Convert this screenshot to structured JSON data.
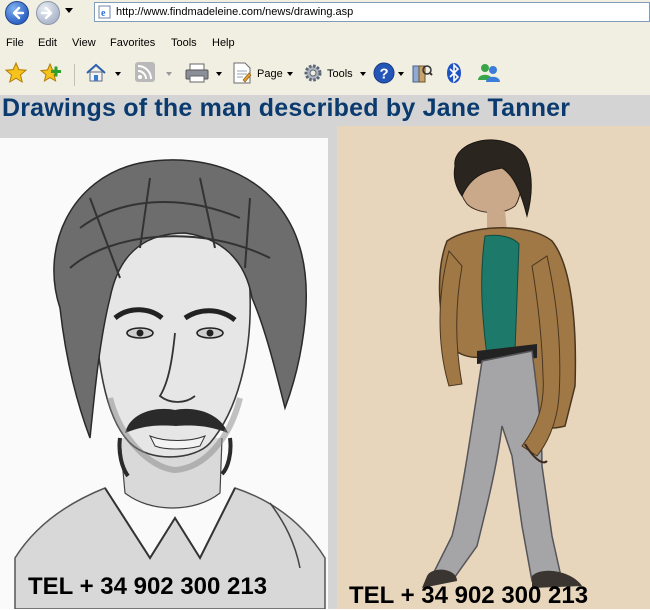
{
  "browser": {
    "url": "http://www.findmadeleine.com/news/drawing.asp",
    "menu": [
      "File",
      "Edit",
      "View",
      "Favorites",
      "Tools",
      "Help"
    ],
    "toolbar": {
      "page_label": "Page",
      "tools_label": "Tools"
    }
  },
  "page": {
    "heading": "Drawings of the man described by Jane Tanner",
    "left_drawing": {
      "caption": "TEL + 34 902 300 213"
    },
    "right_drawing": {
      "caption": "TEL + 34 902 300 213"
    }
  }
}
